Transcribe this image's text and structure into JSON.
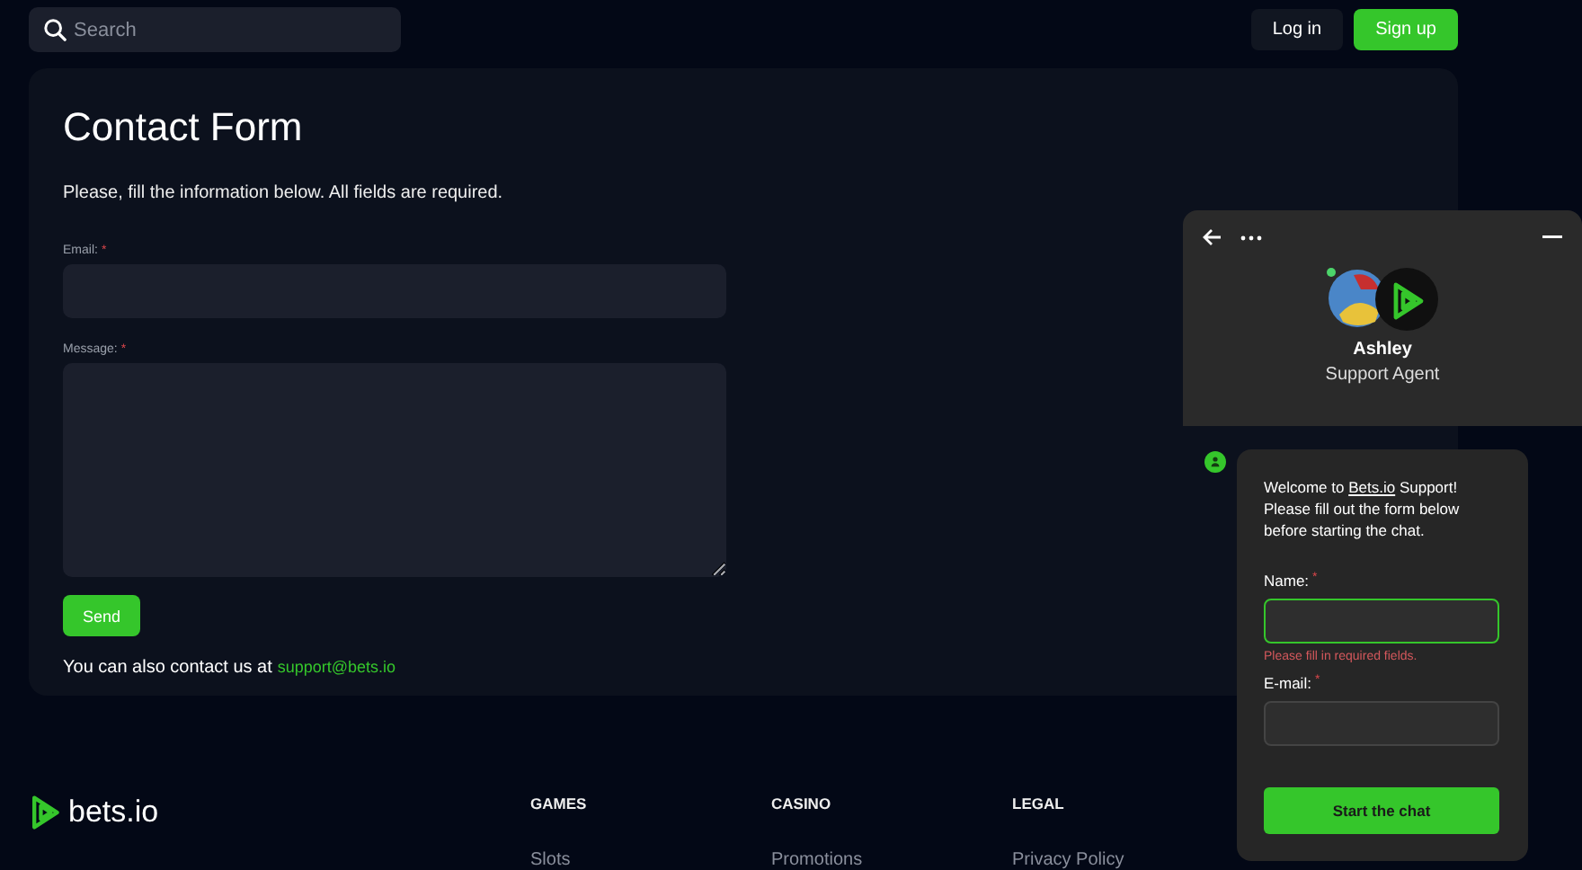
{
  "header": {
    "search": {
      "placeholder": "Search"
    },
    "buttons": [
      {
        "label": "Log in",
        "kind": "secondary"
      },
      {
        "label": "Sign up",
        "kind": "primary"
      }
    ]
  },
  "contact_form": {
    "title": "Contact Form",
    "intro": "Please, fill the information below. All fields are required.",
    "fields": [
      {
        "label": "Email:",
        "required_mark": "*",
        "kind": "input"
      },
      {
        "label": "Message:",
        "required_mark": "*",
        "kind": "textarea"
      }
    ],
    "submit": "Send",
    "contact_text": "You can also contact us at",
    "contact_link": "support@bets.io"
  },
  "chat": {
    "agent_name": "Ashley",
    "agent_role": "Support Agent",
    "online": true,
    "welcome_before": "Welcome to",
    "welcome_link": "Bets.io",
    "welcome_after": "Support! Please fill out the form below before starting the chat.",
    "fields": [
      {
        "label": "Name:",
        "required_mark": "*",
        "error": "Please fill in required fields.",
        "invalid": true
      },
      {
        "label": "E-mail:",
        "required_mark": "*",
        "invalid": false
      }
    ],
    "submit": "Start the chat"
  },
  "footer": {
    "brand": "bets.io",
    "columns": [
      {
        "heading": "GAMES",
        "links": [
          "Slots"
        ]
      },
      {
        "heading": "CASINO",
        "links": [
          "Promotions"
        ]
      },
      {
        "heading": "LEGAL",
        "links": [
          "Privacy Policy"
        ]
      }
    ]
  }
}
